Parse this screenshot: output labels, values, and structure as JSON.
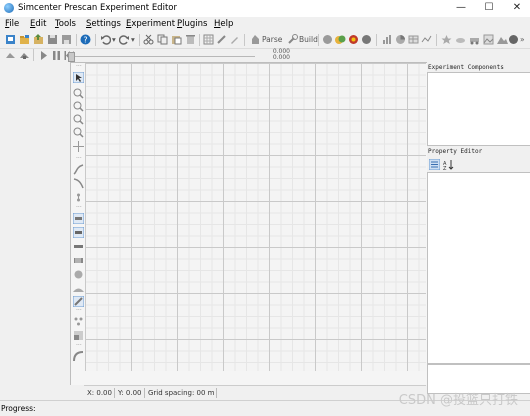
{
  "window": {
    "title": "Simcenter Prescan Experiment Editor",
    "minimize": "—",
    "maximize": "☐",
    "close": "✕"
  },
  "menu": {
    "file": {
      "first": "F",
      "rest": "ile"
    },
    "edit": {
      "first": "E",
      "rest": "dit"
    },
    "tools": {
      "first": "T",
      "rest": "ools"
    },
    "settings": {
      "first": "S",
      "rest": "ettings"
    },
    "experiment": {
      "first": "E",
      "rest": "xperiment"
    },
    "plugins": {
      "first": "P",
      "rest": "lugins"
    },
    "help": {
      "first": "H",
      "rest": "elp"
    }
  },
  "toolbar": {
    "parse_label": "Parse",
    "build_label": "Build",
    "coord_top": "0.000",
    "coord_bottom": "0.000"
  },
  "status": {
    "x": "X: 0.00",
    "y": "Y: 0.00",
    "grid": "Grid spacing: 00 m"
  },
  "panels": {
    "components_title": "Experiment Components",
    "property_title": "Property Editor"
  },
  "progress": {
    "label": "Progress:"
  },
  "watermark": "CSDN @投篮只打铁",
  "colors": {
    "accent": "#1c6bb8",
    "grid_major": "#c9c9c9",
    "grid_minor": "#e6e6e6"
  }
}
